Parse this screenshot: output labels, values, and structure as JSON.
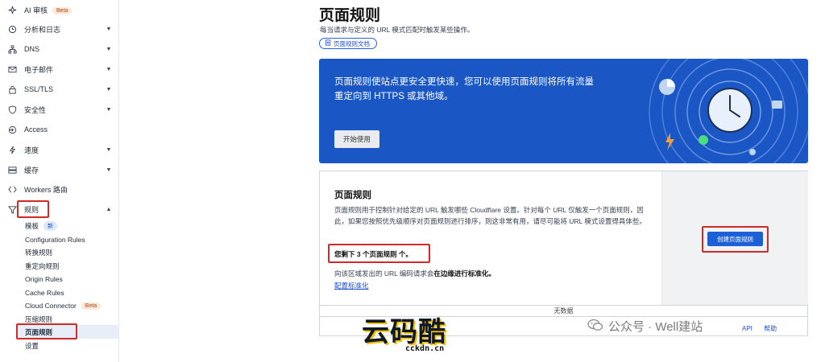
{
  "sidebar": {
    "items": [
      {
        "label": "AI 审核",
        "badge": "Beta",
        "icon": "sparkle-icon",
        "chevron": false
      },
      {
        "label": "分析和日志",
        "icon": "chart-clock-icon",
        "chevron": true
      },
      {
        "label": "DNS",
        "icon": "network-icon",
        "chevron": true
      },
      {
        "label": "电子邮件",
        "icon": "envelope-icon",
        "chevron": true
      },
      {
        "label": "SSL/TLS",
        "icon": "lock-icon",
        "chevron": true
      },
      {
        "label": "安全性",
        "icon": "shield-icon",
        "chevron": true
      },
      {
        "label": "Access",
        "icon": "access-icon",
        "chevron": false
      },
      {
        "label": "速度",
        "icon": "lightning-icon",
        "chevron": true
      },
      {
        "label": "缓存",
        "icon": "server-icon",
        "chevron": true
      },
      {
        "label": "Workers 路由",
        "icon": "workers-icon",
        "chevron": false
      },
      {
        "label": "规则",
        "icon": "rules-icon",
        "chevron": true,
        "expanded": true
      }
    ],
    "sub_items": [
      {
        "label": "模板",
        "badge": "新"
      },
      {
        "label": "Configuration Rules"
      },
      {
        "label": "转换规则"
      },
      {
        "label": "重定向规则"
      },
      {
        "label": "Origin Rules"
      },
      {
        "label": "Cache Rules"
      },
      {
        "label": "Cloud Connector",
        "badge": "Beta"
      },
      {
        "label": "压缩规则"
      },
      {
        "label": "页面规则",
        "active": true
      },
      {
        "label": "设置"
      }
    ]
  },
  "main": {
    "title": "页面规则",
    "subtitle": "每当请求与定义的 URL 模式匹配时触发某些操作。",
    "doc_button": "页面规则文档",
    "hero": {
      "line1": "页面规则使站点更安全更快速，您可以使用页面规则将所有流量",
      "line2": "重定向到 HTTPS 或其他域。",
      "button": "开始使用"
    },
    "panel": {
      "title": "页面规则",
      "description": "页面规则用于控制针对给定的 URL 触发哪些 Cloudflare 设置。针对每个 URL 仅触发一个页面规则，因此，如果您按照优先级顺序对页面规则进行排序，则这非常有用，请尽可能将 URL 模式设置得具体些。",
      "remaining": "您剩下 3 个页面规则 个。",
      "norm_prefix": "向该区域发出的 URL 编码请求会",
      "norm_bold": "在边缘进行标准化。",
      "norm_link": "配置标准化",
      "create_button": "创建页面规则",
      "no_data": "无数据"
    }
  },
  "watermark": {
    "logo_text": "云码酷",
    "domain": "cckdn.cn",
    "wechat": "公众号 · Well建站",
    "api_link": "API",
    "help_link": "帮助"
  },
  "colors": {
    "hero_bg": "#1a56c4",
    "primary_button": "#1d5fd6",
    "highlight_box": "#d12a2a"
  }
}
